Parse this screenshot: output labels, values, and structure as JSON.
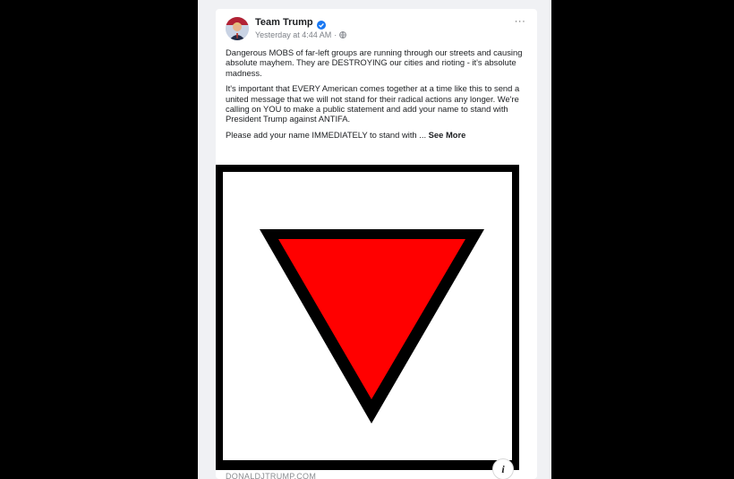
{
  "post": {
    "author": "Team Trump",
    "timestamp": "Yesterday at 4:44 AM",
    "separator": "·",
    "more_label": "···",
    "paragraphs": [
      "Dangerous MOBS of far-left groups are running through our streets and causing absolute mayhem. They are DESTROYING our cities and rioting - it's absolute madness.",
      "It's important that EVERY American comes together at a time like this to send a united message that we will not stand for their radical actions any longer. We're calling on YOU to make a public statement and add your name to stand with President Trump against ANTIFA."
    ],
    "truncated_text": "Please add your name IMMEDIATELY to stand with ... ",
    "see_more_label": "See More"
  },
  "media": {
    "triangle_fill": "#ff0000",
    "triangle_outline": "#000000",
    "info_label": "i"
  },
  "link": {
    "domain": "DONALDJTRUMP.COM"
  },
  "colors": {
    "background": "#000000",
    "feed_background": "#f0f1f4",
    "verified_badge": "#1877f2"
  },
  "icons": {
    "avatar": "avatar",
    "verified": "verified-badge-icon",
    "audience": "globe-icon",
    "more": "more-options-icon",
    "info": "info-icon"
  }
}
